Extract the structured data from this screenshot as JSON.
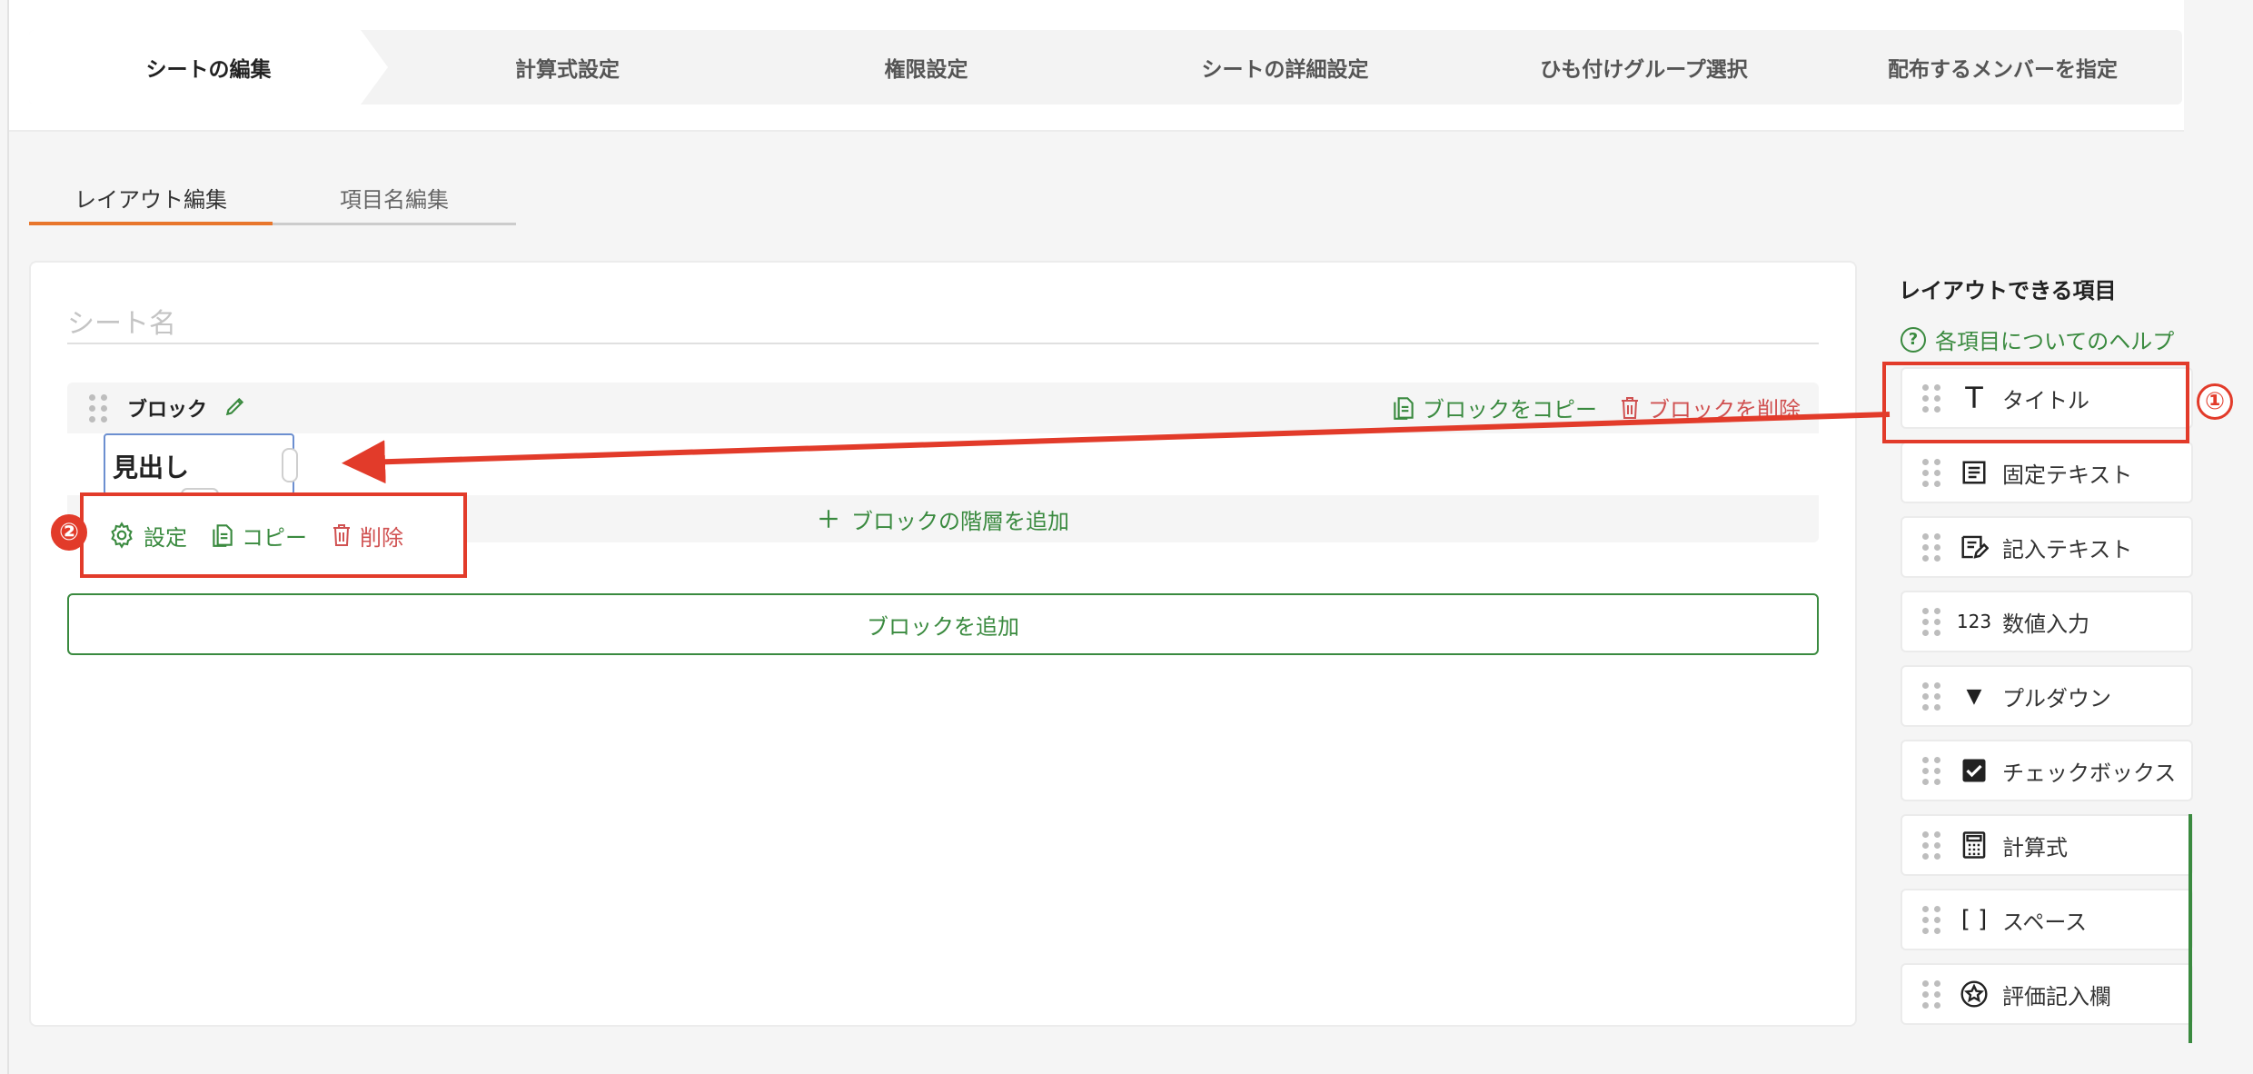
{
  "stepper": {
    "steps": [
      "シートの編集",
      "計算式設定",
      "権限設定",
      "シートの詳細設定",
      "ひも付けグループ選択",
      "配布するメンバーを指定"
    ]
  },
  "subtabs": [
    "レイアウト編集",
    "項目名編集"
  ],
  "editor": {
    "sheet_name_placeholder": "シート名",
    "block_title": "ブロック",
    "copy_block": "ブロックをコピー",
    "delete_block": "ブロックを削除",
    "heading_value": "見出し",
    "add_layer": "ブロックの階層を追加",
    "add_block": "ブロックを追加",
    "tool_settings": "設定",
    "tool_copy": "コピー",
    "tool_delete": "削除"
  },
  "panel": {
    "title": "レイアウトできる項目",
    "help": "各項目についてのヘルプ",
    "items": [
      {
        "label": "タイトル",
        "icon": "T"
      },
      {
        "label": "固定テキスト",
        "icon": "≡"
      },
      {
        "label": "記入テキスト",
        "icon": "✎"
      },
      {
        "label": "数値入力",
        "icon": "123"
      },
      {
        "label": "プルダウン",
        "icon": "▼"
      },
      {
        "label": "チェックボックス",
        "icon": "✔"
      },
      {
        "label": "計算式",
        "icon": "▦"
      },
      {
        "label": "スペース",
        "icon": "[ ]"
      },
      {
        "label": "評価記入欄",
        "icon": "✪"
      }
    ]
  },
  "annotations": {
    "badge1": "①",
    "badge2": "②"
  },
  "colors": {
    "accent_green": "#3a8a3f",
    "danger_red": "#d05151",
    "annotation_red": "#e23b2a",
    "tab_orange": "#e8762c"
  }
}
